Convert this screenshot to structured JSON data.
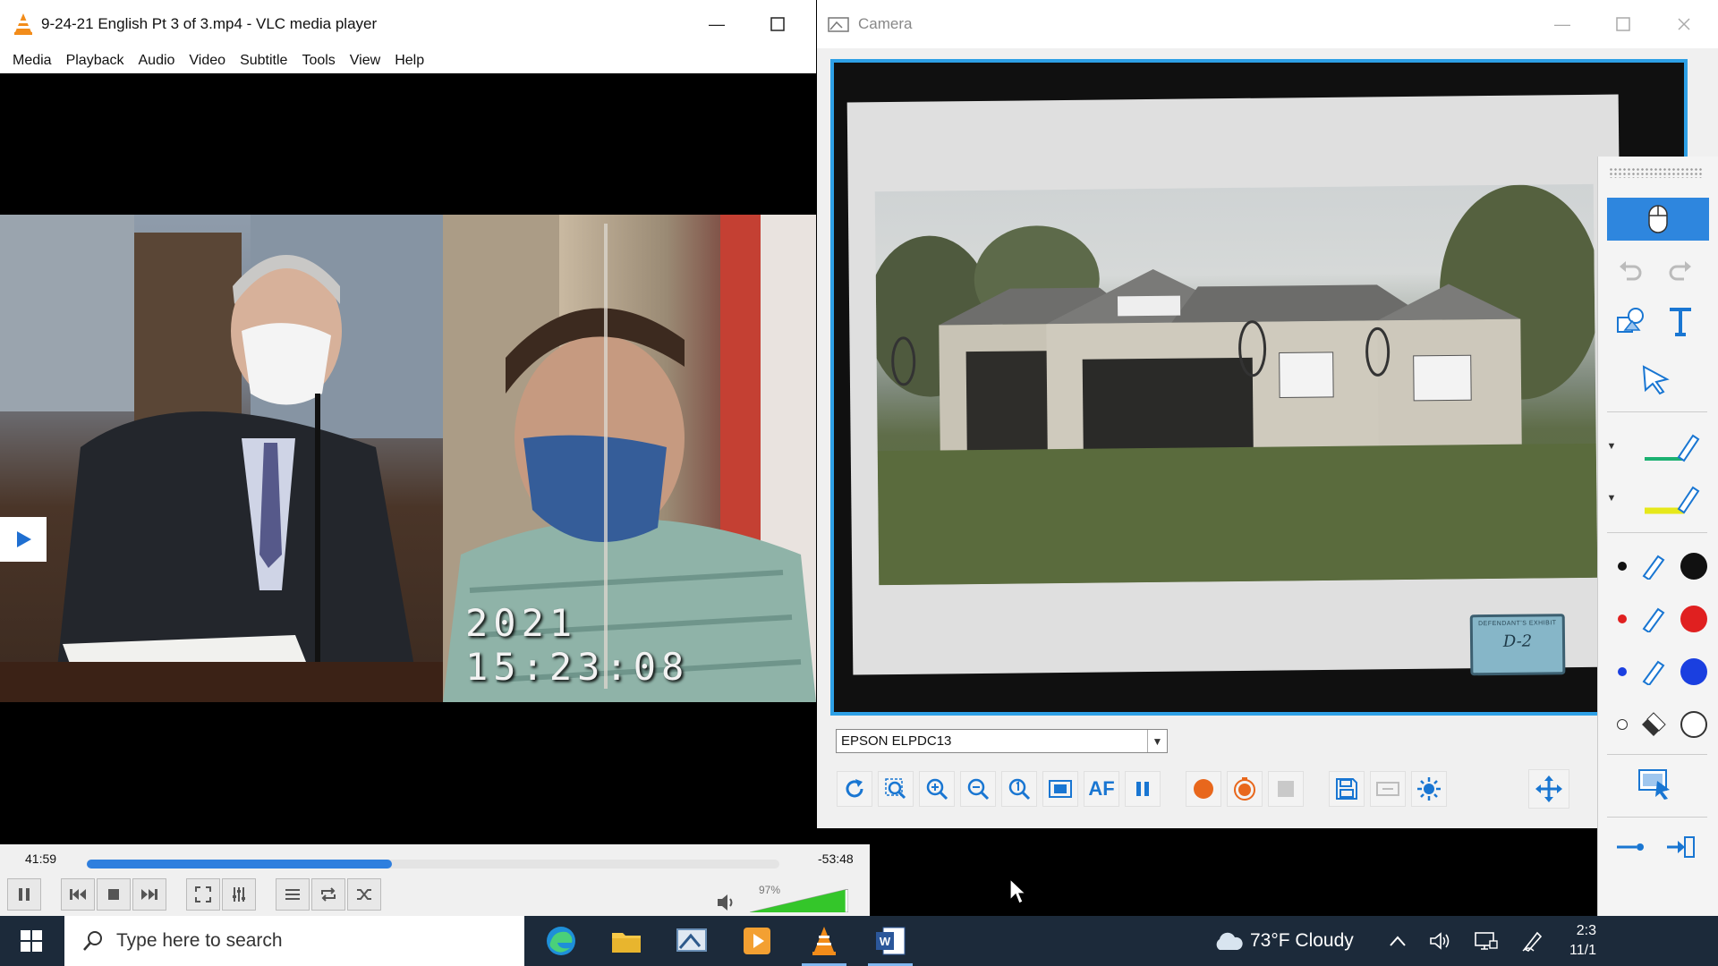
{
  "vlc": {
    "title": "9-24-21 English Pt 3 of 3.mp4 - VLC media player",
    "menu": [
      "Media",
      "Playback",
      "Audio",
      "Video",
      "Subtitle",
      "Tools",
      "View",
      "Help"
    ],
    "video_timestamp": "2021  15:23:08",
    "time_elapsed": "41:59",
    "time_remaining": "-53:48",
    "progress": 0.44,
    "volume_label": "97%",
    "volume": 0.97
  },
  "camera": {
    "title": "Camera",
    "device": "EPSON ELPDC13",
    "af_label": "AF",
    "stamp_text": "DEFENDANT'S EXHIBIT",
    "stamp_number": "D-2",
    "accent": "#2ea0e6"
  },
  "annotation_colors": {
    "black": "#111111",
    "red": "#e02020",
    "blue": "#1a3fe0"
  },
  "taskbar": {
    "search_placeholder": "Type here to search",
    "weather": "73°F  Cloudy",
    "clock_time": "2:3",
    "clock_date": "11/1"
  },
  "icons": {
    "vlc_cone": "vlc-cone-icon",
    "camera": "camera-icon",
    "start": "windows-start-icon"
  }
}
